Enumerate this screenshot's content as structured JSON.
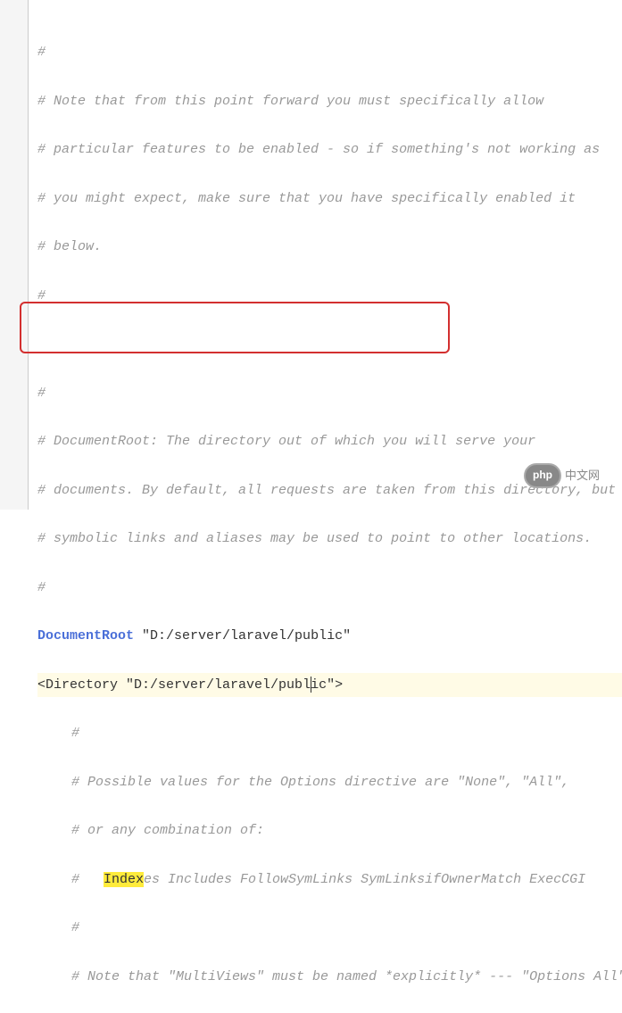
{
  "code": {
    "l1": "#",
    "l2": "# Note that from this point forward you must specifically allow",
    "l3": "# particular features to be enabled - so if something's not working as",
    "l4": "# you might expect, make sure that you have specifically enabled it",
    "l5": "# below.",
    "l6": "#",
    "l7": "",
    "l8": "#",
    "l9": "# DocumentRoot: The directory out of which you will serve your",
    "l10": "# documents. By default, all requests are taken from this directory, but",
    "l11": "# symbolic links and aliases may be used to point to other locations.",
    "l12": "#",
    "l13_kw": "DocumentRoot",
    "l13_val": " \"D:/server/laravel/public\"",
    "l14_open": "<Directory ",
    "l14_path_a": "\"D:/server/laravel/publ",
    "l14_path_b": "ic\"",
    "l14_close": ">",
    "l15": "#",
    "l16": "# Possible values for the Options directive are \"None\", \"All\",",
    "l17": "# or any combination of:",
    "l18_a": "#   ",
    "l18_hl": "Index",
    "l18_b": "es Includes FollowSymLinks SymLinksifOwnerMatch ExecCGI",
    "l19": "#",
    "l20": "# Note that \"MultiViews\" must be named *explicitly* --- \"Options All\""
  },
  "watermark": {
    "logo": "php",
    "text": "中文网"
  }
}
